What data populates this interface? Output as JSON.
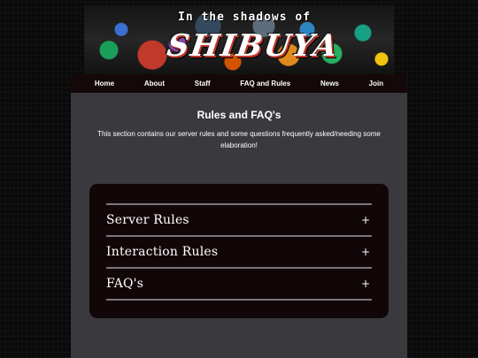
{
  "banner": {
    "subtitle": "In the shadows of",
    "title": "SHIBUYA"
  },
  "nav": {
    "items": [
      "Home",
      "About",
      "Staff",
      "FAQ and Rules",
      "News",
      "Join"
    ]
  },
  "content": {
    "title": "Rules and FAQ's",
    "description": "This section contains our server rules and some questions frequently asked/needing some elaboration!"
  },
  "accordion": {
    "items": [
      {
        "label": "Server Rules",
        "icon": "plus-icon",
        "symbol": "+"
      },
      {
        "label": "Interaction Rules",
        "icon": "plus-icon",
        "symbol": "+"
      },
      {
        "label": "FAQ's",
        "icon": "plus-icon",
        "symbol": "+"
      }
    ]
  },
  "colors": {
    "background": "#0a0a0a",
    "nav_bar": "#140808",
    "panel": "#3a393e",
    "accordion_bg": "#120708",
    "divider": "#7a7778",
    "text": "#ffffff"
  }
}
